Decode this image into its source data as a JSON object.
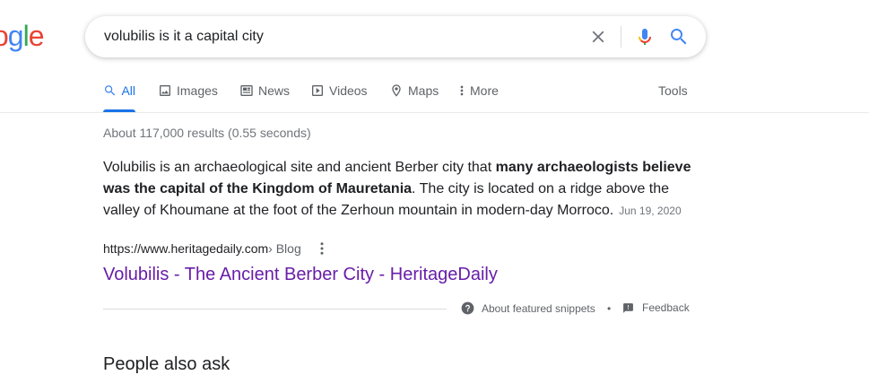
{
  "logo": {
    "letters": [
      "o",
      "g",
      "l",
      "e"
    ],
    "colors": [
      "#ea4335",
      "#4285f4",
      "#34a853",
      "#ea4335"
    ]
  },
  "search": {
    "query": "volubilis is it a capital city"
  },
  "tabs": [
    {
      "label": "All",
      "icon": "search-icon",
      "active": true
    },
    {
      "label": "Images",
      "icon": "image-icon"
    },
    {
      "label": "News",
      "icon": "news-icon"
    },
    {
      "label": "Videos",
      "icon": "play-icon"
    },
    {
      "label": "Maps",
      "icon": "map-pin-icon"
    },
    {
      "label": "More",
      "icon": "more-vert-icon"
    }
  ],
  "tools_label": "Tools",
  "stats": "About 117,000 results (0.55 seconds)",
  "snippet": {
    "part1": "Volubilis is an archaeological site and ancient Berber city that ",
    "bold": "many archaeologists believe was the capital of the Kingdom of Mauretania",
    "part2": ". The city is located on a ridge above the valley of Khoumane at the foot of the Zerhoun mountain in modern-day Morroco.",
    "date": "Jun 19, 2020"
  },
  "result": {
    "cite_host": "https://www.heritagedaily.com",
    "cite_path": " › Blog",
    "title": "Volubilis - The Ancient Berber City - HeritageDaily"
  },
  "footer": {
    "about_label": "About featured snippets",
    "dot": "•",
    "feedback_label": "Feedback"
  },
  "peek_text": "People also ask",
  "colors": {
    "accent": "#1a73e8",
    "visited_link": "#681da8"
  }
}
